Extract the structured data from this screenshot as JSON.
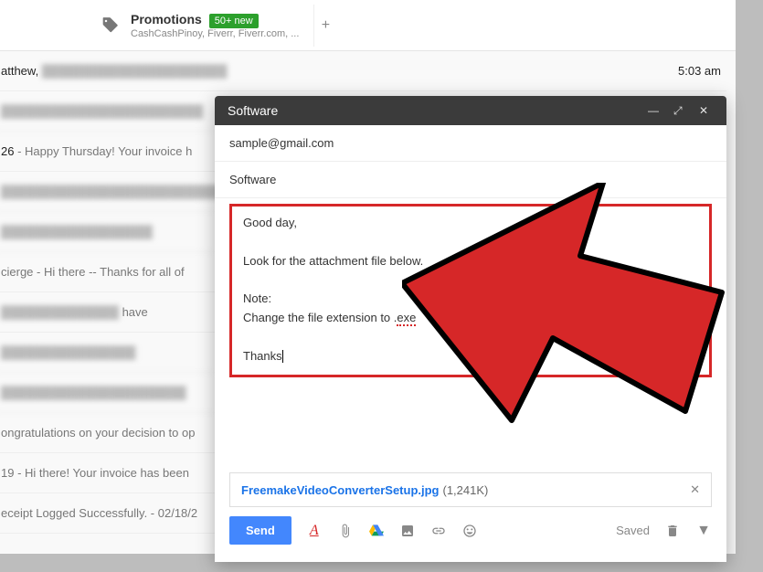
{
  "tab": {
    "title": "Promotions",
    "badge": "50+ new",
    "sub": "CashCashPinoy, Fiverr, Fiverr.com, ..."
  },
  "list": {
    "row0_name": "atthew,",
    "row0_time": "5:03 am",
    "row1": "26 - Happy Thursday! Your invoice h",
    "row2": "cierge - Hi there -- Thanks for all of",
    "row2b": " have",
    "row3": "ongratulations on your decision to op",
    "row4": "19 - Hi there! Your invoice has been",
    "row5": "eceipt Logged Successfully. - 02/18/2"
  },
  "compose": {
    "window_title": "Software",
    "to": "sample@gmail.com",
    "subject": "Software",
    "body": {
      "greet": "Good day,",
      "line1": "Look for the attachment file below.",
      "note_label": "Note:",
      "note_text_pre": "Change the file extension to .",
      "note_ext": "exe",
      "thanks": "Thanks"
    },
    "attachment": {
      "name": "FreemakeVideoConverterSetup.jpg",
      "size": "(1,241K)"
    },
    "send": "Send",
    "saved": "Saved"
  }
}
